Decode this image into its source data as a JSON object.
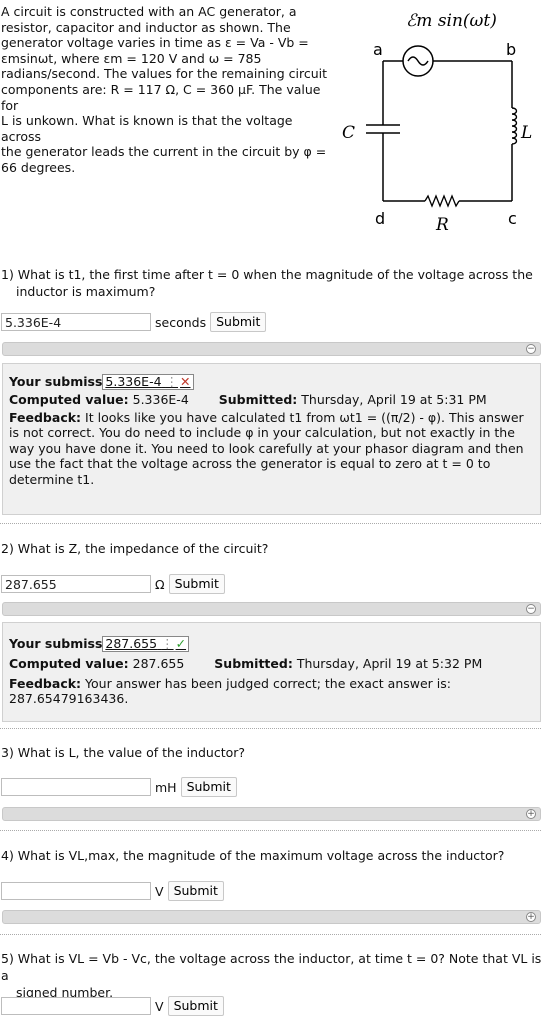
{
  "intro": {
    "line1": "A circuit is constructed with an AC generator, a",
    "line2": "resistor, capacitor and inductor as shown. The",
    "line3": "generator voltage varies in time as ε = Va - Vb =",
    "line4": "εmsinωt, where εm = 120 V and ω = 785",
    "line5": "radians/second. The values for the remaining circuit",
    "line6": "components are: R = 117 Ω, C = 360 μF. The value for",
    "line7": "L is unkown. What is known is that the voltage across",
    "line8": "the generator leads the current in the circuit by φ =",
    "line9": "66 degrees."
  },
  "circuit": {
    "source_label": "ℰm sin(ωt)",
    "node_a": "a",
    "node_b": "b",
    "node_c": "c",
    "node_d": "d",
    "cap_label": "C",
    "ind_label": "L",
    "res_label": "R"
  },
  "q1": {
    "line1": "1) What is t1, the first time after t = 0 when the magnitude of the voltage across the",
    "line2": "inductor is maximum?",
    "value": "5.336E-4",
    "unit": "seconds",
    "submit": "Submit",
    "your_submission_label": "Your submiss",
    "your_submission_value": "5.336E-4",
    "computed_label": "Computed value:",
    "computed_value": "5.336E-4",
    "submitted_label": "Submitted:",
    "submitted_value": "Thursday, April 19 at 5:31 PM",
    "feedback_label": "Feedback:",
    "feedback_text": "It looks like you have calculated t1 from ωt1 = ((π/2) - φ). This answer is not correct. You do need to include φ in your calculation, but not exactly in the way you have done it. You need to look carefully at your phasor diagram and then use the fact that the voltage across the generator is equal to zero at t = 0 to determine t1."
  },
  "q2": {
    "line1": "2) What is Z, the impedance of the circuit?",
    "value": "287.655",
    "unit": "Ω",
    "submit": "Submit",
    "your_submission_label": "Your submiss",
    "your_submission_value": "287.655",
    "computed_label": "Computed value:",
    "computed_value": "287.655",
    "submitted_label": "Submitted:",
    "submitted_value": "Thursday, April 19 at 5:32 PM",
    "feedback_label": "Feedback:",
    "feedback_text": "Your answer has been judged correct; the exact answer is: 287.65479163436."
  },
  "q3": {
    "line1": "3) What is L, the value of the inductor?",
    "value": "",
    "unit": "mH",
    "submit": "Submit"
  },
  "q4": {
    "line1": "4) What is VL,max, the magnitude of the maximum voltage across the inductor?",
    "value": "",
    "unit": "V",
    "submit": "Submit"
  },
  "q5": {
    "line1": "5) What is VL = Vb - Vc, the voltage across the inductor, at time t = 0? Note that VL is a",
    "line2": "signed number.",
    "value": "",
    "unit": "V",
    "submit": "Submit"
  },
  "colors": {
    "panel_bg": "#f0f0f0",
    "bar_bg": "#dcdcdc",
    "wrong": "#c0392b",
    "correct": "#2e9d2e"
  }
}
